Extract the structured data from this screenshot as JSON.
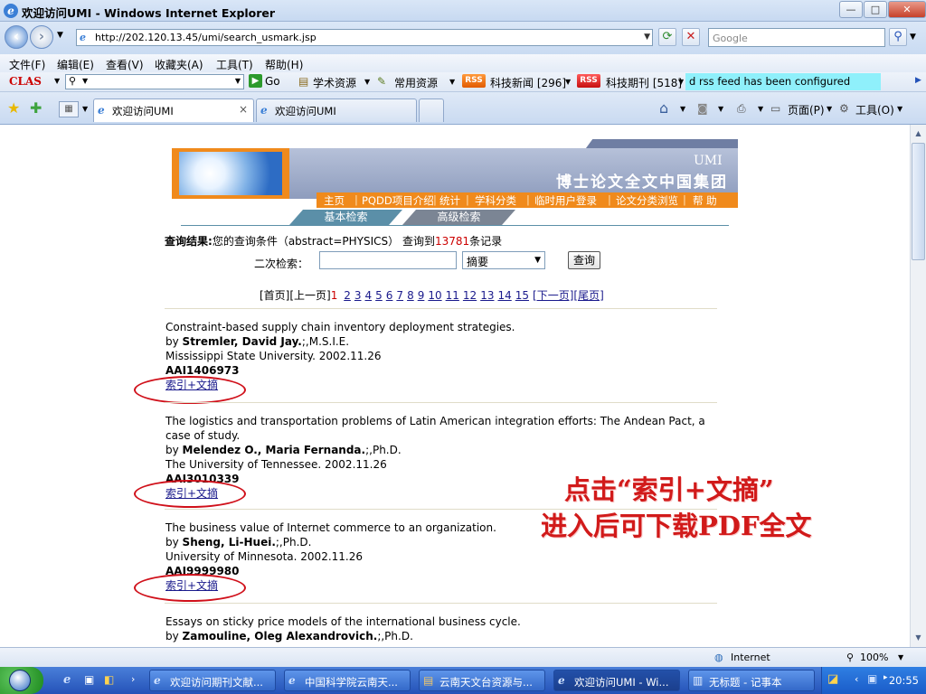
{
  "window": {
    "title": "欢迎访问UMI - Windows Internet Explorer",
    "minimize": "—",
    "restore": "□",
    "close": "✕"
  },
  "address": {
    "url": "http://202.120.13.45/umi/search_usmark.jsp",
    "search_placeholder": "Google"
  },
  "menu": [
    "文件(F)",
    "编辑(E)",
    "查看(V)",
    "收藏夹(A)",
    "工具(T)",
    "帮助(H)"
  ],
  "linkbar": {
    "clas": "CLAS",
    "go": "Go",
    "academic": "学术资源",
    "common": "常用资源",
    "rss": "RSS",
    "news": "科技新闻 [296]",
    "journals": "科技期刊 [518]",
    "note": "d rss feed has been configured"
  },
  "tabs": [
    {
      "label": "欢迎访问UMI",
      "active": true
    },
    {
      "label": "欢迎访问UMI",
      "active": false
    }
  ],
  "toolbar": {
    "page": "页面(P)",
    "tools": "工具(O)"
  },
  "site": {
    "brand": "UMI",
    "title": "博士论文全文中国集团",
    "nav": [
      "主页",
      "PQDD项目介绍",
      "统计",
      "学科分类",
      "临时用户登录",
      "论文分类浏览",
      "帮 助"
    ],
    "tab_basic": "基本检索",
    "tab_advanced": "高级检索"
  },
  "query": {
    "label": "查询结果:",
    "text": "您的查询条件（abstract=PHYSICS） 查询到",
    "count": "13781",
    "suffix": "条记录"
  },
  "secondary": {
    "label": "二次检索：",
    "value": "",
    "field": "摘要",
    "button": "查询"
  },
  "pager": {
    "first": "[首页]",
    "prev": "[上一页]",
    "current": "1",
    "pages": [
      "2",
      "3",
      "4",
      "5",
      "6",
      "7",
      "8",
      "9",
      "10",
      "11",
      "12",
      "13",
      "14",
      "15"
    ],
    "next": "[下一页]",
    "last": "[尾页]"
  },
  "records": [
    {
      "title": "Constraint-based supply chain inventory deployment strategies.",
      "by": "by ",
      "author": "Stremler, David Jay.",
      "degree": ";,M.S.I.E.",
      "school": "Mississippi State University. 2002.11.26",
      "id": "AAI1406973",
      "link": "索引+文摘"
    },
    {
      "title": "The logistics and transportation problems of Latin American integration efforts: The Andean Pact, a case of study.",
      "by": "by ",
      "author": "Melendez O., Maria Fernanda.",
      "degree": ";,Ph.D.",
      "school": "The University of Tennessee. 2002.11.26",
      "id": "AAI3010339",
      "link": "索引+文摘"
    },
    {
      "title": "The business value of Internet commerce to an organization.",
      "by": "by ",
      "author": "Sheng, Li-Huei.",
      "degree": ";,Ph.D.",
      "school": "University of Minnesota. 2002.11.26",
      "id": "AAI9999980",
      "link": "索引+文摘"
    },
    {
      "title": "Essays on sticky price models of the international business cycle.",
      "by": "by ",
      "author": "Zamouline, Oleg Alexandrovich.",
      "degree": ";,Ph.D.",
      "school": "",
      "id": "",
      "link": ""
    }
  ],
  "annotation": {
    "line1": "点击“索引+文摘”",
    "line2": "进入后可下载PDF全文"
  },
  "status": {
    "zone": "Internet",
    "zoom": "100%"
  },
  "taskbar": {
    "items": [
      {
        "label": "欢迎访问期刊文献...",
        "active": false
      },
      {
        "label": "中国科学院云南天...",
        "active": false
      },
      {
        "label": "云南天文台资源与...",
        "active": false
      },
      {
        "label": "欢迎访问UMI - Wi...",
        "active": true
      },
      {
        "label": "无标题 - 记事本",
        "active": false
      }
    ],
    "clock": "20:55"
  },
  "colors": {
    "accent_orange": "#f08a1c",
    "count_red": "#cc0000",
    "annotation_red": "#d11a1a"
  }
}
